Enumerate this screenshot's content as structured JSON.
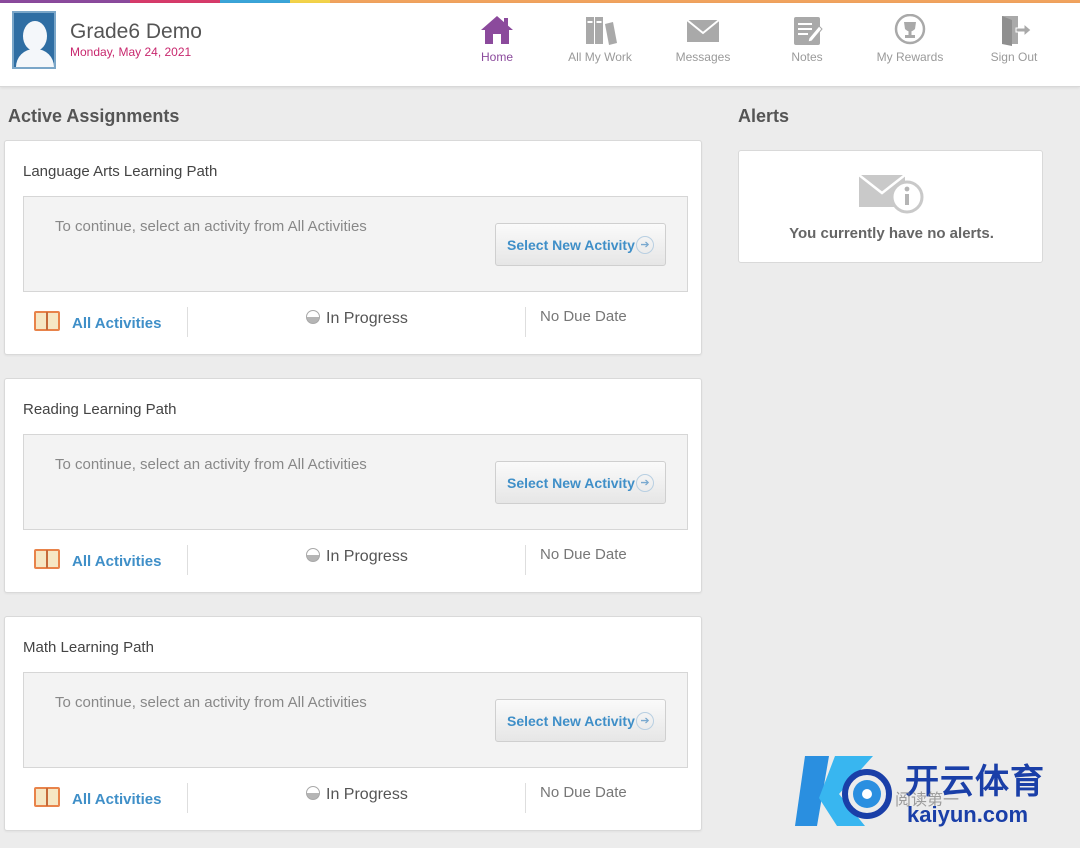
{
  "user": {
    "name": "Grade6 Demo",
    "date": "Monday, May 24, 2021"
  },
  "nav": [
    {
      "label": "Home",
      "icon": "home-icon",
      "active": true
    },
    {
      "label": "All My Work",
      "icon": "books-icon",
      "active": false
    },
    {
      "label": "Messages",
      "icon": "envelope-icon",
      "active": false
    },
    {
      "label": "Notes",
      "icon": "notes-icon",
      "active": false
    },
    {
      "label": "My Rewards",
      "icon": "trophy-icon",
      "active": false
    },
    {
      "label": "Sign Out",
      "icon": "sign-out-icon",
      "active": false
    }
  ],
  "assignments": {
    "title": "Active Assignments",
    "items": [
      {
        "title": "Language Arts Learning Path",
        "message": "To continue, select an activity from All Activities",
        "button": "Select New Activity",
        "link": "All Activities",
        "status": "In Progress",
        "due": "No Due Date"
      },
      {
        "title": "Reading Learning Path",
        "message": "To continue, select an activity from All Activities",
        "button": "Select New Activity",
        "link": "All Activities",
        "status": "In Progress",
        "due": "No Due Date"
      },
      {
        "title": "Math Learning Path",
        "message": "To continue, select an activity from All Activities",
        "button": "Select New Activity",
        "link": "All Activities",
        "status": "In Progress",
        "due": "No Due Date"
      }
    ]
  },
  "alerts": {
    "title": "Alerts",
    "message": "You currently have no alerts."
  },
  "watermark": {
    "title": "开云体育",
    "url": "kaiyun.com",
    "sub": "阅读第一"
  },
  "colors": {
    "accent": "#8b4a9c",
    "date": "#c8286e",
    "link": "#3f8fc8"
  }
}
